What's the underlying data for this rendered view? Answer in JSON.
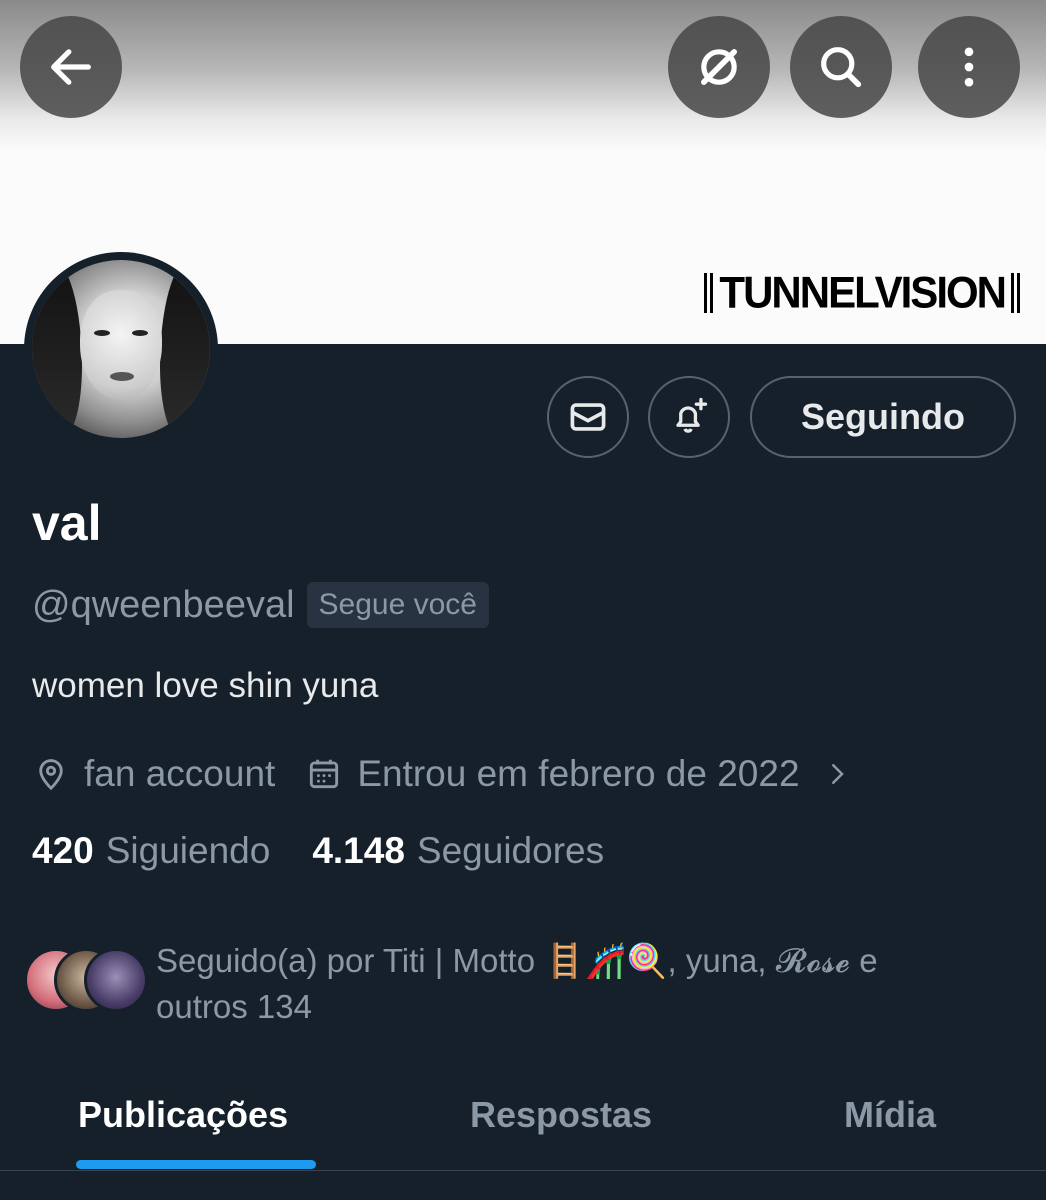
{
  "banner": {
    "logo_text": "TUNNELVISION"
  },
  "top_bar": {
    "back_icon": "arrow-left-icon",
    "grok_icon": "slashed-circle-icon",
    "search_icon": "search-icon",
    "more_icon": "more-vertical-icon"
  },
  "actions": {
    "message_icon": "envelope-icon",
    "notify_icon": "bell-plus-icon",
    "follow_label": "Seguindo"
  },
  "profile": {
    "name": "val",
    "handle": "@qweenbeeval",
    "follows_you": "Segue você",
    "bio": "women love shin yuna",
    "location": "fan account",
    "joined": "Entrou em febrero de 2022"
  },
  "counts": {
    "following_num": "420",
    "following_label": "Siguiendo",
    "followers_num": "4.148",
    "followers_label": "Seguidores"
  },
  "followed_by": {
    "text": "Seguido(a) por Titi | Motto 🪜🎢🍭, yuna, 𝓡𝓸𝓼𝓮 e outros 134"
  },
  "tabs": [
    {
      "label": "Publicações",
      "active": true
    },
    {
      "label": "Respostas",
      "active": false
    },
    {
      "label": "Mídia",
      "active": false
    }
  ],
  "colors": {
    "background": "#15202b",
    "accent": "#1d9bf0",
    "secondary_text": "#8b98a5"
  }
}
